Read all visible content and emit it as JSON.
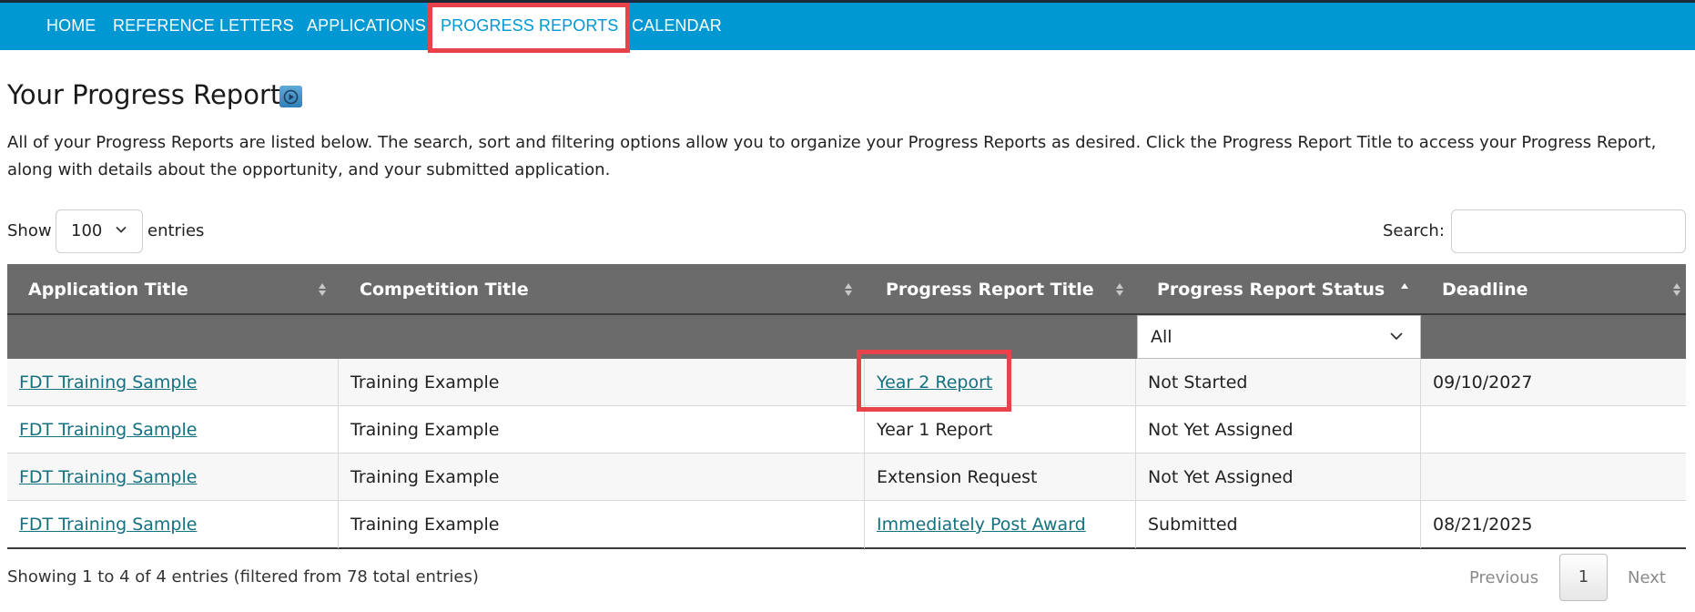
{
  "nav": {
    "items": [
      {
        "label": "HOME",
        "active": false
      },
      {
        "label": "REFERENCE LETTERS",
        "active": false
      },
      {
        "label": "APPLICATIONS",
        "active": false
      },
      {
        "label": "PROGRESS REPORTS",
        "active": true
      },
      {
        "label": "CALENDAR",
        "active": false
      }
    ]
  },
  "page": {
    "title": "Your Progress Report",
    "title_icon": "video-play-icon",
    "intro": "All of your Progress Reports are listed below. The search, sort and filtering options allow you to organize your Progress Reports as desired. Click the Progress Report Title to access your Progress Report, along with details about the opportunity, and your submitted application."
  },
  "controls": {
    "show_label": "Show",
    "entries_value": "100",
    "entries_label": "entries",
    "search_label": "Search:",
    "search_value": ""
  },
  "table": {
    "headers": [
      "Application Title",
      "Competition Title",
      "Progress Report Title",
      "Progress Report Status",
      "Deadline"
    ],
    "status_filter_value": "All",
    "rows": [
      {
        "application": "FDT Training Sample",
        "competition": "Training Example",
        "report": "Year 2 Report",
        "report_link": true,
        "status": "Not Started",
        "deadline": "09/10/2027"
      },
      {
        "application": "FDT Training Sample",
        "competition": "Training Example",
        "report": "Year 1 Report",
        "report_link": false,
        "status": "Not Yet Assigned",
        "deadline": ""
      },
      {
        "application": "FDT Training Sample",
        "competition": "Training Example",
        "report": "Extension Request",
        "report_link": false,
        "status": "Not Yet Assigned",
        "deadline": ""
      },
      {
        "application": "FDT Training Sample",
        "competition": "Training Example",
        "report": "Immediately Post Award",
        "report_link": true,
        "status": "Submitted",
        "deadline": "08/21/2025"
      }
    ]
  },
  "footer": {
    "info": "Showing 1 to 4 of 4 entries (filtered from 78 total entries)",
    "previous": "Previous",
    "current_page": "1",
    "next": "Next"
  },
  "colors": {
    "nav_bg": "#0098d3",
    "highlight": "#e8424a",
    "table_header_bg": "#6b6b6b",
    "link": "#137180"
  }
}
